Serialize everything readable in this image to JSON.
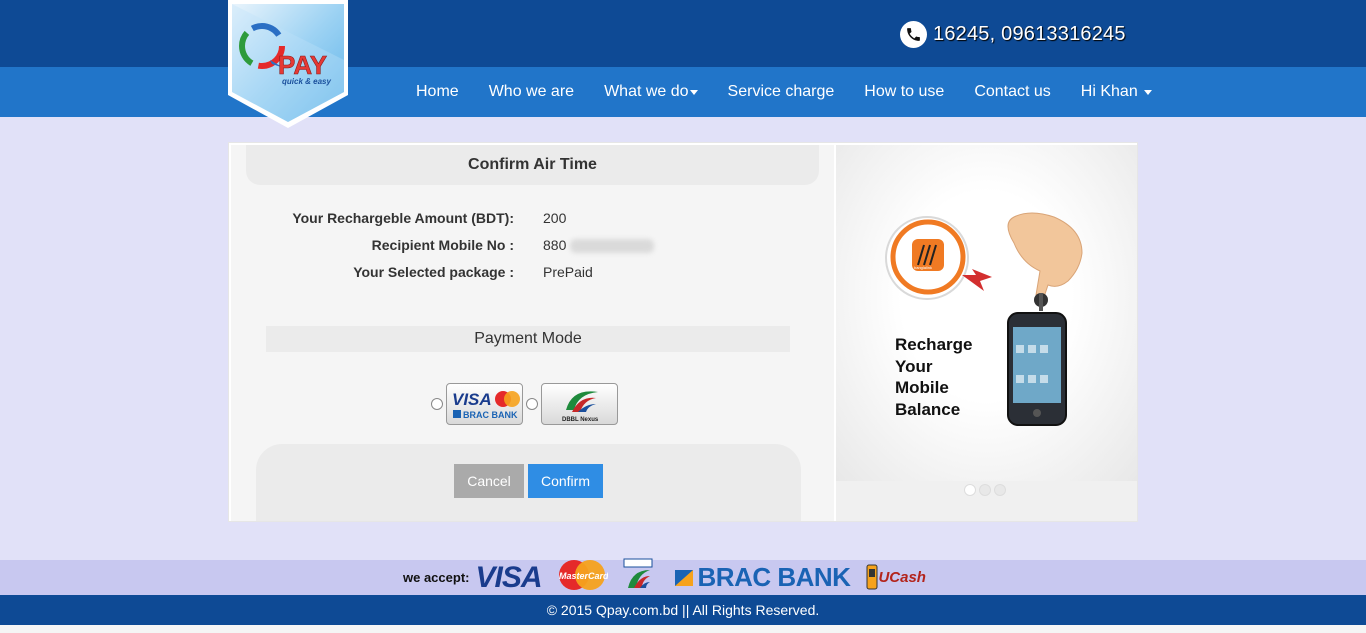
{
  "header": {
    "phone": "16245, 09613316245",
    "phone_icon": "phone-icon"
  },
  "logo": {
    "brand": "PAY",
    "tagline": "quick & easy"
  },
  "nav": {
    "items": [
      {
        "label": "Home",
        "dropdown": false
      },
      {
        "label": "Who we are",
        "dropdown": false
      },
      {
        "label": "What we do",
        "dropdown": true
      },
      {
        "label": "Service charge",
        "dropdown": false
      },
      {
        "label": "How to use",
        "dropdown": false
      },
      {
        "label": "Contact us",
        "dropdown": false
      },
      {
        "label": "Hi Khan",
        "dropdown": true
      }
    ]
  },
  "confirm": {
    "title": "Confirm Air Time",
    "rows": [
      {
        "label": "Your Rechargeble Amount (BDT):",
        "value": "200"
      },
      {
        "label": "Recipient Mobile No :",
        "value": "880"
      },
      {
        "label": "Your Selected package :",
        "value": "PrePaid"
      }
    ],
    "payment_mode": "Payment Mode",
    "payment_options": [
      {
        "name": "visa-mastercard-brac-bank",
        "label_top": "VISA",
        "label_bottom": "BRAC BANK"
      },
      {
        "name": "dbbl-nexus",
        "label_bottom": "DBBL Nexus"
      }
    ],
    "cancel_label": "Cancel",
    "confirm_label": "Confirm"
  },
  "banner": {
    "line1": "Recharge",
    "line2": "Your",
    "line3": "Mobile",
    "line4": "Balance",
    "operator_label": "banglalink",
    "slides": 3,
    "active_slide": 1
  },
  "accept": {
    "label": "we accept:",
    "logos": [
      "VISA",
      "MasterCard",
      "DBBL",
      "BRAC BANK",
      "UCash"
    ]
  },
  "footer": {
    "copyright": "© 2015 Qpay.com.bd || All Rights Reserved."
  },
  "colors": {
    "topbar": "#0e4a95",
    "navbar": "#2175c9",
    "page_bg": "#e1e1f8",
    "confirm_button": "#2f8de4",
    "cancel_button": "#aaaaaa",
    "accept_bar": "#c8c8f0"
  }
}
